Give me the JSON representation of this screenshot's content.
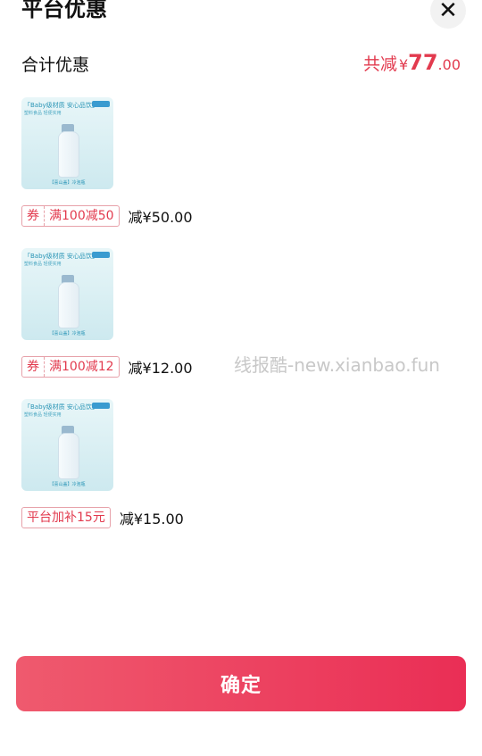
{
  "header": {
    "title": "平台优惠",
    "close_icon": "close-icon"
  },
  "summary": {
    "label": "合计优惠",
    "prefix": "共减",
    "currency": "¥",
    "amount_int": "77",
    "amount_dec": ".00"
  },
  "product_image": {
    "headline": "「Baby级材质 安心品饮」",
    "subline": "塑料食品 轻便实用",
    "footer": "【喜山盖】冷泡瓶"
  },
  "items": [
    {
      "coupon_tag": "券",
      "coupon_text": "满100减50",
      "reduce_text": "减¥50.00"
    },
    {
      "coupon_tag": "券",
      "coupon_text": "满100减12",
      "reduce_text": "减¥12.00"
    },
    {
      "coupon_tag": "",
      "coupon_text": "平台加补15元",
      "reduce_text": "减¥15.00"
    }
  ],
  "watermark": "线报酷-new.xianbao.fun",
  "confirm_button": {
    "label": "确定"
  },
  "colors": {
    "accent": "#e23a4e",
    "button_start": "#ef5a6e",
    "button_end": "#ea2e55"
  }
}
